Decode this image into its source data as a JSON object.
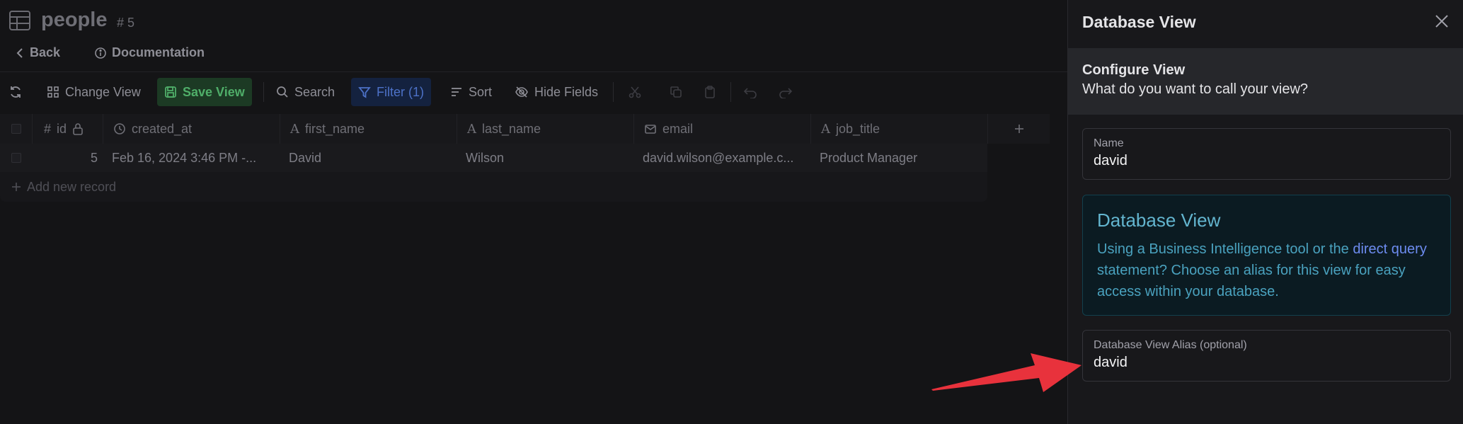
{
  "table": {
    "title": "people",
    "number": "# 5"
  },
  "nav": {
    "back_label": "Back",
    "docs_label": "Documentation"
  },
  "toolbar": {
    "change_view_label": "Change View",
    "save_view_label": "Save View",
    "search_label": "Search",
    "filter_label": "Filter (1)",
    "sort_label": "Sort",
    "hide_fields_label": "Hide Fields"
  },
  "grid": {
    "columns": [
      {
        "name": "id",
        "icon": "hash-icon"
      },
      {
        "name": "created_at",
        "icon": "clock-icon"
      },
      {
        "name": "first_name",
        "icon": "text-icon"
      },
      {
        "name": "last_name",
        "icon": "text-icon"
      },
      {
        "name": "email",
        "icon": "mail-icon"
      },
      {
        "name": "job_title",
        "icon": "text-icon"
      }
    ],
    "rows": [
      {
        "id": "5",
        "created_at": "Feb 16, 2024 3:46 PM -...",
        "first_name": "David",
        "last_name": "Wilson",
        "email": "david.wilson@example.c...",
        "job_title": "Product Manager"
      }
    ],
    "add_record_label": "Add new record"
  },
  "panel": {
    "title": "Database View",
    "section_heading": "Configure View",
    "section_subheading": "What do you want to call your view?",
    "name_field": {
      "label": "Name",
      "value": "david"
    },
    "info": {
      "title": "Database View",
      "text_before": "Using a Business Intelligence tool or the ",
      "link_text": "direct query",
      "text_after": " statement? Choose an alias for this view for easy access within your database."
    },
    "alias_field": {
      "label": "Database View Alias (optional)",
      "value": "david"
    }
  },
  "colors": {
    "save_green": "#4fae69",
    "filter_blue": "#4d72c8",
    "info_cyan": "#63b5cf",
    "link_blue": "#6d8cf0",
    "annotation_arrow": "#e8323c"
  }
}
